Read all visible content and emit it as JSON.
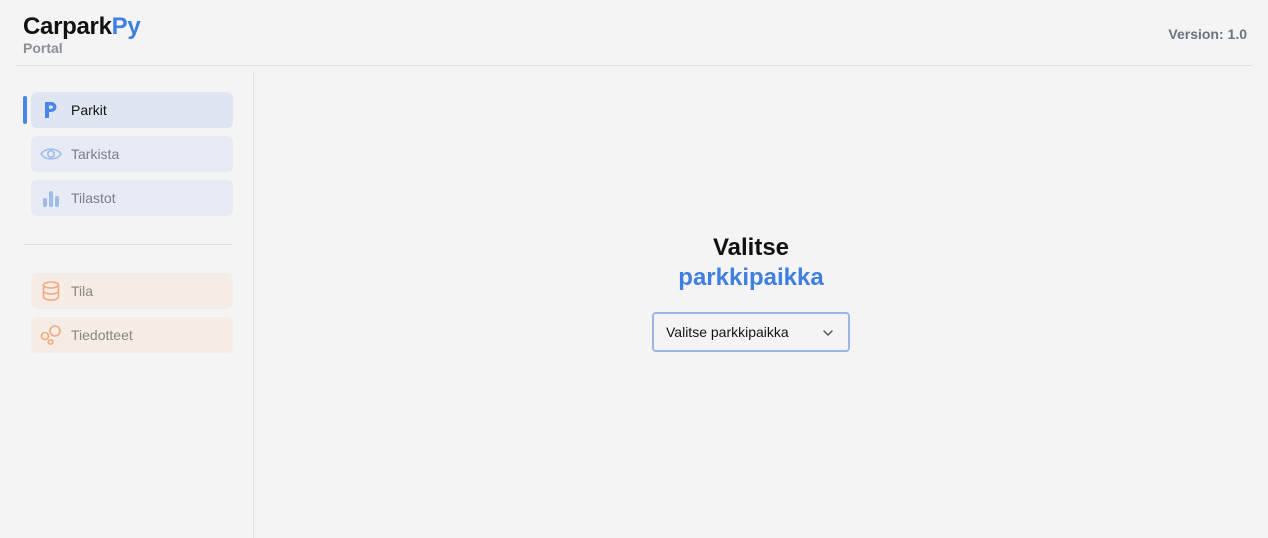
{
  "app": {
    "title_main": "Carpark",
    "title_accent": "Py",
    "subtitle": "Portal",
    "version": "Version: 1.0",
    "accent_color": "#3f7fe0"
  },
  "sidebar": {
    "primary_items": [
      {
        "label": "Parkit",
        "icon": "parking-icon",
        "active": true
      },
      {
        "label": "Tarkista",
        "icon": "eye-icon",
        "active": false
      },
      {
        "label": "Tilastot",
        "icon": "bar-chart-icon",
        "active": false
      }
    ],
    "secondary_items": [
      {
        "label": "Tila",
        "icon": "database-icon"
      },
      {
        "label": "Tiedotteet",
        "icon": "bubbles-icon"
      }
    ]
  },
  "main": {
    "heading_line1": "Valitse",
    "heading_line2": "parkkipaikka",
    "select": {
      "selected": "Valitse parkkipaikka",
      "icon": "chevron-down-icon"
    }
  }
}
